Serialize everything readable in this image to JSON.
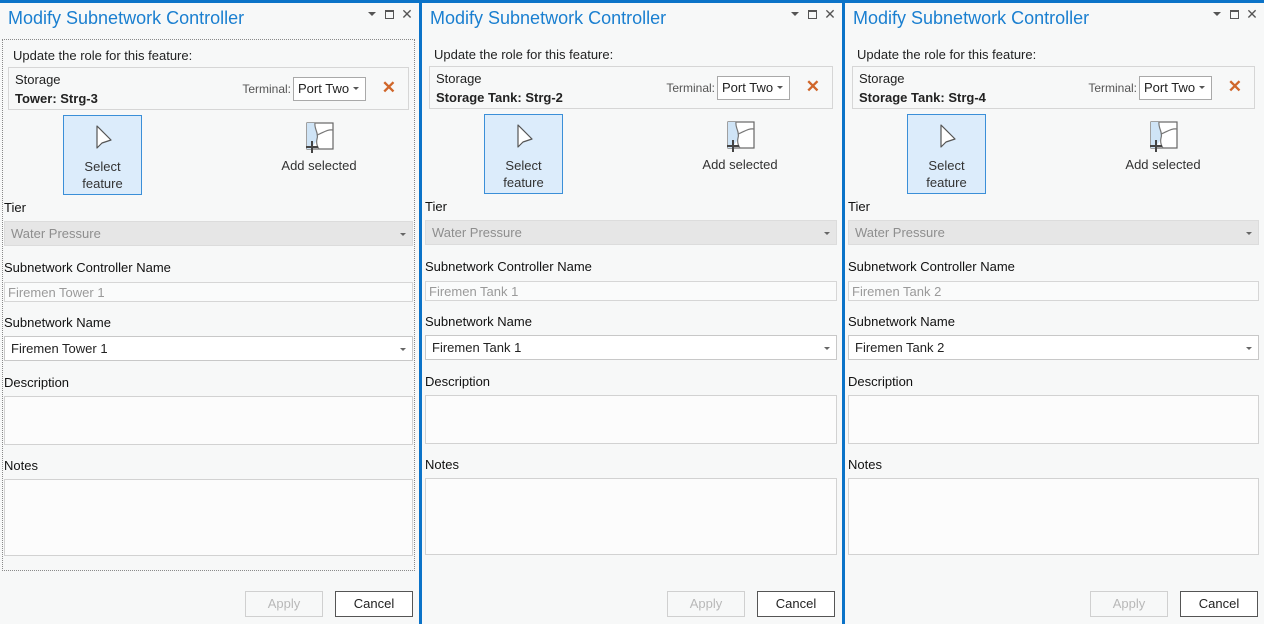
{
  "panels": [
    {
      "title": "Modify Subnetwork Controller",
      "update_label": "Update the role for this feature:",
      "feature": {
        "type": "Storage",
        "name": "Tower: Strg-3"
      },
      "terminal_label": "Terminal:",
      "terminal_value": "Port Two",
      "select_feature_label": [
        "Select",
        "feature"
      ],
      "add_selected_label": "Add selected",
      "tier_label": "Tier",
      "tier_value": "Water Pressure",
      "controller_name_label": "Subnetwork Controller Name",
      "controller_name_placeholder": "Firemen Tower 1",
      "subnetwork_name_label": "Subnetwork Name",
      "subnetwork_name_value": "Firemen Tower 1",
      "description_label": "Description",
      "description_value": "",
      "notes_label": "Notes",
      "notes_value": "",
      "apply_label": "Apply",
      "cancel_label": "Cancel"
    },
    {
      "title": "Modify Subnetwork Controller",
      "update_label": "Update the role for this feature:",
      "feature": {
        "type": "Storage",
        "name": "Storage Tank: Strg-2"
      },
      "terminal_label": "Terminal:",
      "terminal_value": "Port Two",
      "select_feature_label": [
        "Select",
        "feature"
      ],
      "add_selected_label": "Add selected",
      "tier_label": "Tier",
      "tier_value": "Water Pressure",
      "controller_name_label": "Subnetwork Controller Name",
      "controller_name_placeholder": "Firemen Tank 1",
      "subnetwork_name_label": "Subnetwork Name",
      "subnetwork_name_value": "Firemen Tank 1",
      "description_label": "Description",
      "description_value": "",
      "notes_label": "Notes",
      "notes_value": "",
      "apply_label": "Apply",
      "cancel_label": "Cancel"
    },
    {
      "title": "Modify Subnetwork Controller",
      "update_label": "Update the role for this feature:",
      "feature": {
        "type": "Storage",
        "name": "Storage Tank: Strg-4"
      },
      "terminal_label": "Terminal:",
      "terminal_value": "Port Two",
      "select_feature_label": [
        "Select",
        "feature"
      ],
      "add_selected_label": "Add selected",
      "tier_label": "Tier",
      "tier_value": "Water Pressure",
      "controller_name_label": "Subnetwork Controller Name",
      "controller_name_placeholder": "Firemen Tank 2",
      "subnetwork_name_label": "Subnetwork Name",
      "subnetwork_name_value": "Firemen Tank 2",
      "description_label": "Description",
      "description_value": "",
      "notes_label": "Notes",
      "notes_value": "",
      "apply_label": "Apply",
      "cancel_label": "Cancel"
    }
  ],
  "colors": {
    "accent": "#0b73c8",
    "title": "#1a7fd0",
    "remove": "#d0662a",
    "selected_tool_bg": "#dcecfb"
  },
  "window_controls": [
    "menu-dropdown-icon",
    "maximize-icon",
    "close-icon"
  ]
}
